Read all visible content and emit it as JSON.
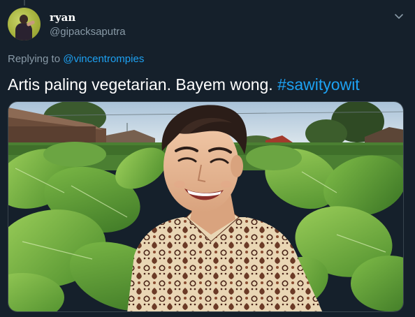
{
  "tweet": {
    "display_name": "ryan",
    "handle": "@gipacksaputra",
    "replying_prefix": "Replying to",
    "replying_to": "@vincentrompies",
    "text": "Artis paling vegetarian. Bayem wong.",
    "hashtag": "#sawityowit",
    "menu_icon": "chevron-down-icon",
    "media_description_icon": "photo"
  },
  "colors": {
    "background": "#15202b",
    "link": "#1da1f2",
    "secondary_text": "#8899a6",
    "primary_text": "#ffffff"
  }
}
